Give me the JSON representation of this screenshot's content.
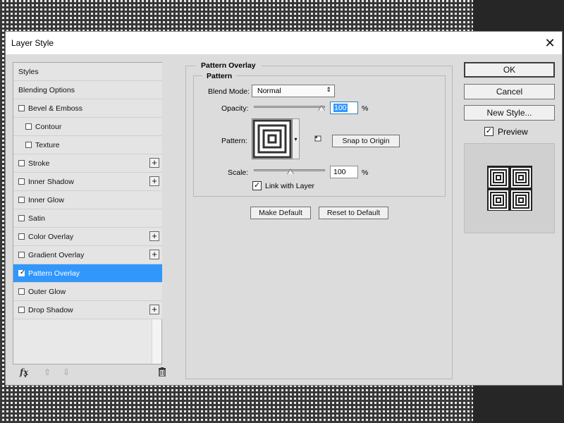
{
  "window": {
    "title": "Layer Style"
  },
  "styles_list": {
    "items": [
      {
        "label": "Styles",
        "has_checkbox": false,
        "checked": false,
        "has_plus": false,
        "indent": false,
        "selected": false
      },
      {
        "label": "Blending Options",
        "has_checkbox": false,
        "checked": false,
        "has_plus": false,
        "indent": false,
        "selected": false
      },
      {
        "label": "Bevel & Emboss",
        "has_checkbox": true,
        "checked": false,
        "has_plus": false,
        "indent": false,
        "selected": false
      },
      {
        "label": "Contour",
        "has_checkbox": true,
        "checked": false,
        "has_plus": false,
        "indent": true,
        "selected": false
      },
      {
        "label": "Texture",
        "has_checkbox": true,
        "checked": false,
        "has_plus": false,
        "indent": true,
        "selected": false
      },
      {
        "label": "Stroke",
        "has_checkbox": true,
        "checked": false,
        "has_plus": true,
        "indent": false,
        "selected": false
      },
      {
        "label": "Inner Shadow",
        "has_checkbox": true,
        "checked": false,
        "has_plus": true,
        "indent": false,
        "selected": false
      },
      {
        "label": "Inner Glow",
        "has_checkbox": true,
        "checked": false,
        "has_plus": false,
        "indent": false,
        "selected": false
      },
      {
        "label": "Satin",
        "has_checkbox": true,
        "checked": false,
        "has_plus": false,
        "indent": false,
        "selected": false
      },
      {
        "label": "Color Overlay",
        "has_checkbox": true,
        "checked": false,
        "has_plus": true,
        "indent": false,
        "selected": false
      },
      {
        "label": "Gradient Overlay",
        "has_checkbox": true,
        "checked": false,
        "has_plus": true,
        "indent": false,
        "selected": false
      },
      {
        "label": "Pattern Overlay",
        "has_checkbox": true,
        "checked": true,
        "has_plus": false,
        "indent": false,
        "selected": true
      },
      {
        "label": "Outer Glow",
        "has_checkbox": true,
        "checked": false,
        "has_plus": false,
        "indent": false,
        "selected": false
      },
      {
        "label": "Drop Shadow",
        "has_checkbox": true,
        "checked": false,
        "has_plus": true,
        "indent": false,
        "selected": false
      }
    ],
    "footer": {
      "fx": "fx",
      "up_icon": "arrow-up-icon",
      "down_icon": "arrow-down-icon",
      "trash_icon": "trash-icon"
    }
  },
  "pattern_overlay": {
    "section_title": "Pattern Overlay",
    "group_title": "Pattern",
    "blend_mode_label": "Blend Mode:",
    "blend_mode_value": "Normal",
    "opacity_label": "Opacity:",
    "opacity_value": "100",
    "opacity_level": 1.0,
    "pattern_label": "Pattern:",
    "snap_to_origin": "Snap to Origin",
    "scale_label": "Scale:",
    "scale_value": "100",
    "scale_level": 0.5,
    "percent": "%",
    "link_with_layer_label": "Link with Layer",
    "link_with_layer_checked": true,
    "make_default": "Make Default",
    "reset_to_default": "Reset to Default"
  },
  "actions": {
    "ok": "OK",
    "cancel": "Cancel",
    "new_style": "New Style...",
    "preview_label": "Preview",
    "preview_checked": true
  },
  "colors": {
    "selection": "#3297fd",
    "dialog_bg": "#dcdcdc"
  }
}
